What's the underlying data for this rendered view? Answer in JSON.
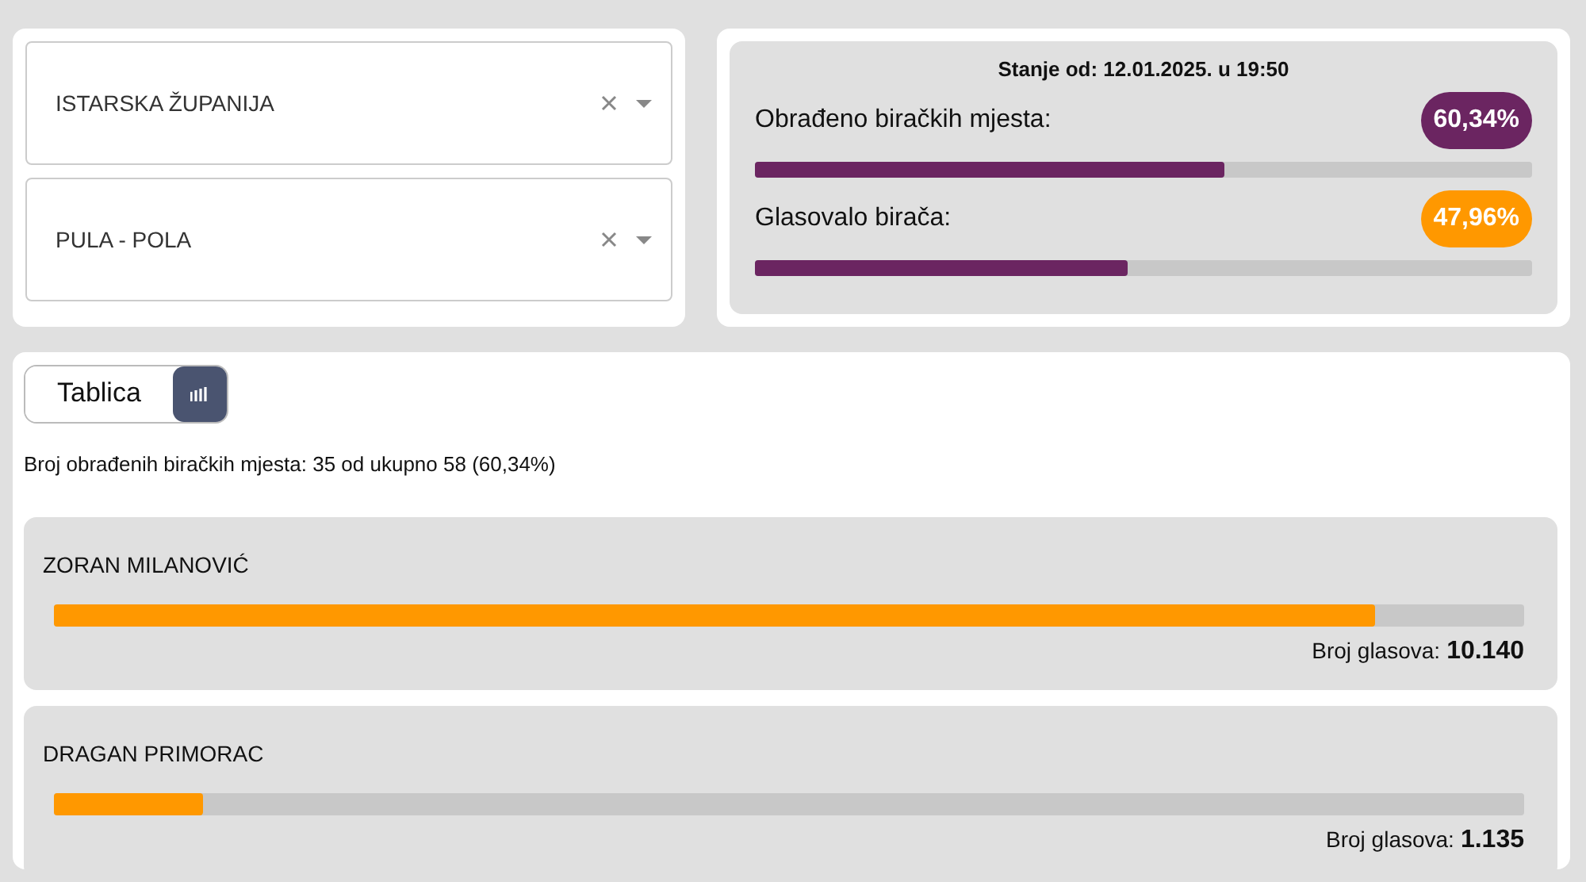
{
  "filters": [
    {
      "value": "ISTARSKA ŽUPANIJA"
    },
    {
      "value": "PULA - POLA"
    }
  ],
  "status": {
    "title": "Stanje od: 12.01.2025. u 19:50",
    "stats": [
      {
        "label": "Obrađeno biračkih mjesta:",
        "badge": "60,34%",
        "color": "#6b2561",
        "level": 0.6034
      },
      {
        "label": "Glasovalo birača:",
        "badge": "47,96%",
        "color": "#ff9800",
        "level": 0.4796
      }
    ]
  },
  "view_toggle": [
    {
      "kind": "text",
      "label": "Tablica",
      "selected": false
    },
    {
      "kind": "icon",
      "selected": true
    }
  ],
  "summary": "Broj obrađenih biračkih mjesta: 35 od ukupno 58 (60,34%)",
  "candidates": [
    {
      "name": "ZORAN MILANOVIĆ",
      "level": 0.899,
      "votes_label": "Broj glasova:",
      "votes": "10.140"
    },
    {
      "name": "DRAGAN PRIMORAC",
      "level": 0.101,
      "votes_label": "Broj glasova:",
      "votes": "1.135"
    }
  ]
}
